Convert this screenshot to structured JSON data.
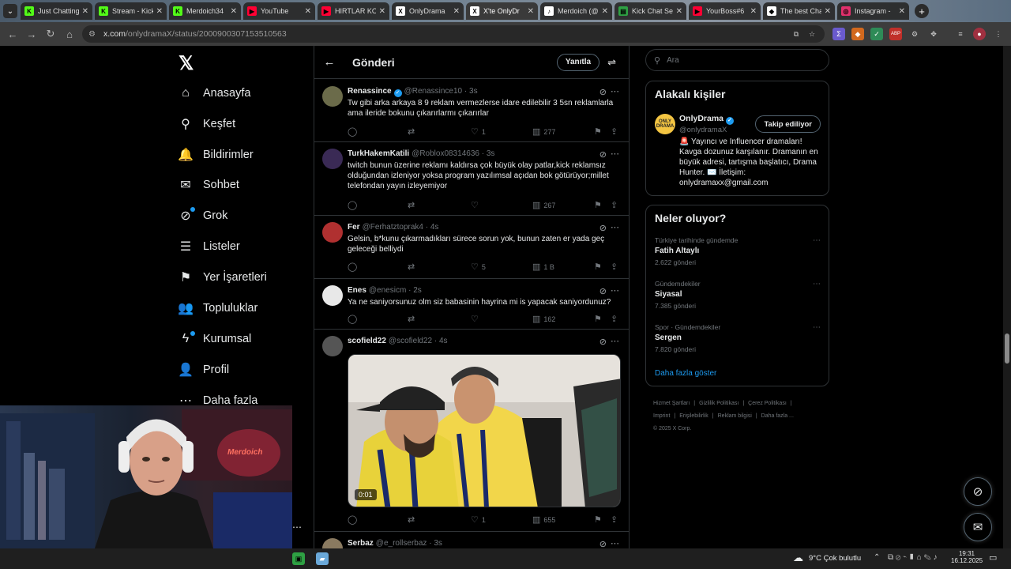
{
  "browser": {
    "tabs": [
      {
        "title": "Just Chatting",
        "fav_color": "#53fc18",
        "fav_glyph": "K"
      },
      {
        "title": "Stream - Kick",
        "fav_color": "#53fc18",
        "fav_glyph": "K"
      },
      {
        "title": "Merdoich34",
        "fav_color": "#53fc18",
        "fav_glyph": "K"
      },
      {
        "title": "YouTube",
        "fav_color": "#ff0033",
        "fav_glyph": "▶"
      },
      {
        "title": "HIRTLAR KO",
        "fav_color": "#ff0033",
        "fav_glyph": "▶"
      },
      {
        "title": "OnlyDrama",
        "fav_color": "#ffffff",
        "fav_glyph": "X"
      },
      {
        "title": "X'te OnlyDr",
        "fav_color": "#ffffff",
        "fav_glyph": "X"
      },
      {
        "title": "Merdoich (@",
        "fav_color": "#ffffff",
        "fav_glyph": "♪"
      },
      {
        "title": "Kick Chat Se",
        "fav_color": "#2ea043",
        "fav_glyph": "▤"
      },
      {
        "title": "YourBoss#6",
        "fav_color": "#ff0033",
        "fav_glyph": "▶"
      },
      {
        "title": "The best Cha",
        "fav_color": "#ffffff",
        "fav_glyph": "◆"
      },
      {
        "title": "Instagram -",
        "fav_color": "#e1306c",
        "fav_glyph": "◎"
      }
    ],
    "active_tab_index": 6,
    "url_domain": "x.com",
    "url_path": "/onlydramaX/status/2000900307153510563"
  },
  "left_nav": [
    {
      "label": "Anasayfa",
      "icon": "home-icon",
      "glyph": "⌂"
    },
    {
      "label": "Keşfet",
      "icon": "search-icon",
      "glyph": "⚲"
    },
    {
      "label": "Bildirimler",
      "icon": "bell-icon",
      "glyph": "🔔"
    },
    {
      "label": "Sohbet",
      "icon": "mail-icon",
      "glyph": "✉"
    },
    {
      "label": "Grok",
      "icon": "grok-icon",
      "glyph": "⊘"
    },
    {
      "label": "Listeler",
      "icon": "list-icon",
      "glyph": "☰"
    },
    {
      "label": "Yer İşaretleri",
      "icon": "bookmark-icon",
      "glyph": "⚑"
    },
    {
      "label": "Topluluklar",
      "icon": "communities-icon",
      "glyph": "👥"
    },
    {
      "label": "Kurumsal",
      "icon": "lightning-icon",
      "glyph": "ϟ"
    },
    {
      "label": "Profil",
      "icon": "person-icon",
      "glyph": "👤"
    },
    {
      "label": "Daha fazla",
      "icon": "more-circle-icon",
      "glyph": "⋯"
    }
  ],
  "header": {
    "title": "Gönderi",
    "reply_button": "Yanıtla"
  },
  "posts": [
    {
      "name": "Renassince",
      "verified": true,
      "handle": "@Renassince10",
      "time": "3s",
      "text": "Tw gibi arka arkaya 8 9 reklam vermezlerse idare edilebilir 3 5sn reklamlarla ama ileride bokunu çıkarırlarmı çıkarırlar",
      "likes": "1",
      "views": "277",
      "avatar_color": "#6b6b4a"
    },
    {
      "name": "TurkHakemKatili",
      "verified": false,
      "handle": "@Roblox08314636",
      "time": "3s",
      "text": "twitch bunun üzerine reklamı kaldırsa çok büyük olay patlar,kick reklamsız olduğundan izleniyor yoksa program yazılımsal açıdan bok götürüyor;millet telefondan yayın izleyemiyor",
      "likes": "",
      "views": "267",
      "avatar_color": "#3a2a55"
    },
    {
      "name": "Fer",
      "verified": false,
      "handle": "@Ferhatztoprak4",
      "time": "4s",
      "text": "Gelsin, b*kunu çıkarmadıkları sürece sorun yok, bunun zaten er yada geç geleceği belliydi",
      "likes": "5",
      "views": "1 B",
      "avatar_color": "#b03030"
    },
    {
      "name": "Enes",
      "verified": false,
      "handle": "@enesicm",
      "time": "2s",
      "text": "Ya ne saniyorsunuz olm siz babasinin hayrina mi is yapacak saniyordunuz?",
      "likes": "",
      "views": "162",
      "avatar_color": "#e8e8e8"
    },
    {
      "name": "scofield22",
      "verified": false,
      "handle": "@scofield22",
      "time": "4s",
      "text": "",
      "likes": "1",
      "views": "655",
      "video_time": "0:01",
      "avatar_color": "#555555"
    },
    {
      "name": "Serbaz",
      "verified": false,
      "handle": "@e_rollserbaz",
      "time": "3s",
      "text": "",
      "avatar_color": "#8a7a60"
    }
  ],
  "right": {
    "search_placeholder": "Ara",
    "related": {
      "heading": "Alakalı kişiler",
      "name": "OnlyDrama",
      "handle": "@onlydramaX",
      "follow_label": "Takip ediliyor",
      "bio": "🚨 Yayıncı ve Influencer dramaları! Kavga dozunuz karşılanır. Dramanın en büyük adresi, tartışma başlatıcı, Drama Hunter. ✉️ İletişim: onlydramaxx@gmail.com"
    },
    "trends": {
      "heading": "Neler oluyor?",
      "items": [
        {
          "context": "Türkiye tarihinde gündemde",
          "title": "Fatih Altaylı",
          "count": "2.622 gönderi"
        },
        {
          "context": "Gündemdekiler",
          "title": "Siyasal",
          "count": "7.385 gönderi"
        },
        {
          "context": "Spor · Gündemdekiler",
          "title": "Sergen",
          "count": "7.820 gönderi"
        }
      ],
      "show_more": "Daha fazla göster"
    },
    "footer": [
      "Hizmet Şartları",
      "|",
      "Gizlilik Politikası",
      "|",
      "Çerez Politikası",
      "|",
      "Imprint",
      "|",
      "Erişilebilirlik",
      "|",
      "Reklam bilgisi",
      "|",
      "Daha fazla ...",
      "© 2025 X Corp."
    ]
  },
  "webcam": {
    "sign_text": "Merdoich"
  },
  "taskbar": {
    "weather": "9°C  Çok bulutlu",
    "time": "19:31",
    "date": "16.12.2025"
  }
}
